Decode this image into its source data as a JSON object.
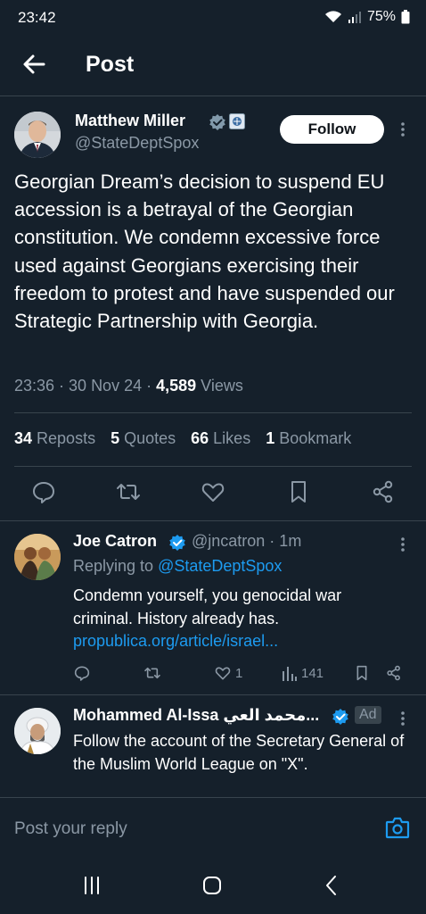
{
  "status_bar": {
    "time": "23:42",
    "battery": "75%"
  },
  "header": {
    "title": "Post"
  },
  "tweet": {
    "author_name": "Matthew Miller",
    "author_handle": "@StateDeptSpox",
    "follow_label": "Follow",
    "text": "Georgian Dream’s decision to suspend EU accession is a betrayal of the Georgian constitution. We condemn excessive force used against Georgians exercising their freedom to protest and have suspended our Strategic Partnership with Georgia.",
    "time_date": "23:36 · 30 Nov 24 · ",
    "views_count": "4,589",
    "views_label": " Views",
    "stats": {
      "reposts_count": "34",
      "reposts_label": "Reposts",
      "quotes_count": "5",
      "quotes_label": "Quotes",
      "likes_count": "66",
      "likes_label": "Likes",
      "bookmarks_count": "1",
      "bookmarks_label": "Bookmark"
    },
    "action_icons": [
      "reply-icon",
      "repost-icon",
      "like-icon",
      "bookmark-icon",
      "share-icon"
    ]
  },
  "reply": {
    "author_name": "Joe Catron",
    "author_handle": "@jncatron · 1m",
    "replying_prefix": "Replying to ",
    "replying_to": "@StateDeptSpox",
    "text": "Condemn yourself, you genocidal war criminal. History already has.",
    "link": "propublica.org/article/israel...",
    "likes": "1",
    "views": "141"
  },
  "ad": {
    "author_name": "Mohammed Al-Issa محمد العي...",
    "tag": "Ad",
    "text": "Follow the account of the Secretary General of the Muslim World League on \"X\"."
  },
  "composer": {
    "placeholder": "Post your reply"
  },
  "colors": {
    "background": "#15202b",
    "divider": "#38444d",
    "accent": "#1d9bf0",
    "muted": "#8b98a5",
    "gov_badge": "#829aab"
  }
}
